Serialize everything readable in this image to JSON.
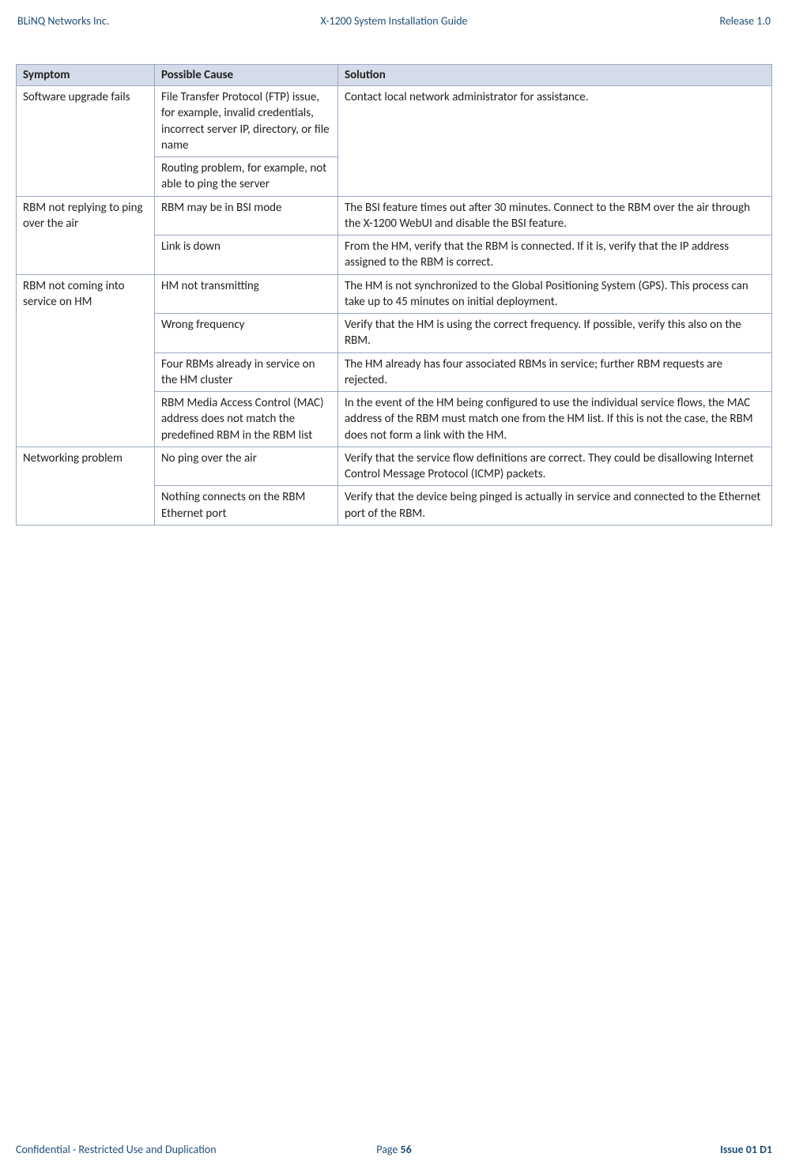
{
  "header": {
    "left": "BLiNQ Networks Inc.",
    "center": "X-1200 System Installation Guide",
    "right": "Release 1.0"
  },
  "table": {
    "headers": {
      "c1": "Symptom",
      "c2": "Possible Cause",
      "c3": "Solution"
    },
    "rows": {
      "r0c0": "Software upgrade fails",
      "r0c1": "File Transfer Protocol (FTP) issue, for example, invalid credentials, incorrect server IP, directory, or file name",
      "r0c2": "Contact local network administrator for assistance.",
      "r1c1": "Routing problem, for example, not able to ping the server",
      "r2c0": "RBM not replying to ping over the air",
      "r2c1": "RBM may be in BSI mode",
      "r2c2": "The BSI feature times out after 30 minutes. Connect to the RBM over the air through the X-1200 WebUI and disable the BSI feature.",
      "r3c1": "Link is down",
      "r3c2": "From the HM, verify that the RBM is connected. If it is, verify that the IP address assigned to the RBM is correct.",
      "r4c0": "RBM not coming into service on HM",
      "r4c1": "HM not transmitting",
      "r4c2": "The HM is not synchronized to the Global Positioning System (GPS). This process can take up to 45 minutes on initial deployment.",
      "r5c1": "Wrong frequency",
      "r5c2": "Verify that the HM is using the correct frequency. If possible, verify this also on the RBM.",
      "r6c1": "Four RBMs already in service on the HM cluster",
      "r6c2": "The HM already has four associated RBMs in service; further RBM requests are rejected.",
      "r7c1": "RBM Media Access Control (MAC) address does not match the predefined RBM in the RBM list",
      "r7c2": "In the event of the HM being configured to use the individual service flows, the MAC address of the RBM must match one from the HM list. If this is not the case, the RBM does not form a link with the HM.",
      "r8c0": "Networking problem",
      "r8c1": "No ping over the air",
      "r8c2": "Verify that the service flow definitions are correct. They could be disallowing Internet Control Message Protocol (ICMP) packets.",
      "r9c1": "Nothing connects on the RBM Ethernet port",
      "r9c2": "Verify that the device being pinged is actually in service and connected to the Ethernet port of the RBM."
    }
  },
  "footer": {
    "left": "Confidential - Restricted Use and Duplication",
    "center_prefix": "Page ",
    "center_page": "56",
    "right": "Issue 01 D1"
  }
}
